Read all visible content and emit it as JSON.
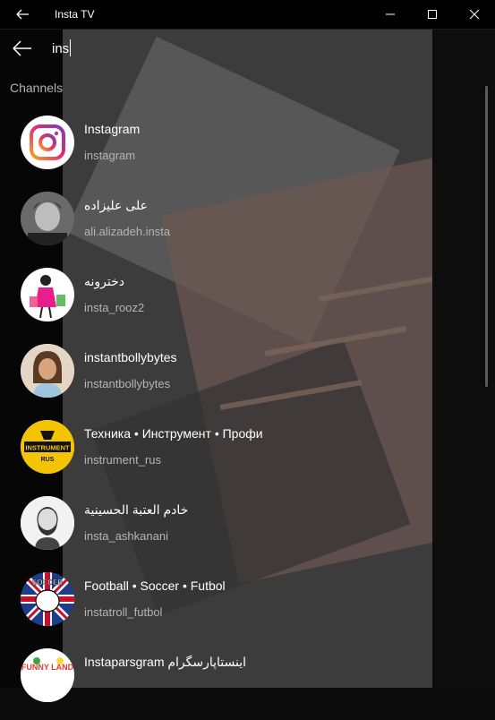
{
  "window": {
    "title": "Insta TV"
  },
  "search": {
    "value": "ins"
  },
  "section": {
    "label": "Channels"
  },
  "channels": [
    {
      "name": "Instagram",
      "handle": "instagram",
      "avatar": "instagram-logo"
    },
    {
      "name": "علی علیزاده",
      "handle": "ali.alizadeh.insta",
      "avatar": "portrait-bw"
    },
    {
      "name": "دخترونه",
      "handle": "insta_rooz2",
      "avatar": "girl-shopping"
    },
    {
      "name": "instantbollybytes",
      "handle": "instantbollybytes",
      "avatar": "woman-portrait"
    },
    {
      "name": "Техника • Инструмент • Профи",
      "handle": "instrument_rus",
      "avatar": "instrument-rus",
      "avatar_text": "INSTRUMENT",
      "avatar_sub": "RUS"
    },
    {
      "name": "خادم العتبة الحسينية",
      "handle": "insta_ashkanani",
      "avatar": "man-sketch"
    },
    {
      "name": "Football • Soccer • Futbol",
      "handle": "instatroll_futbol",
      "avatar": "soccer-troll",
      "avatar_text": "SOCCER"
    },
    {
      "name": "Instaparsgram اینستاپارسگرام",
      "handle": "",
      "avatar": "funny-land",
      "avatar_text": "FUNNY LAND"
    }
  ],
  "colors": {
    "titlebar": "#000000",
    "panel_overlay": "rgba(0,0,0,0.45)",
    "accent_instagram": "#e1306c"
  }
}
